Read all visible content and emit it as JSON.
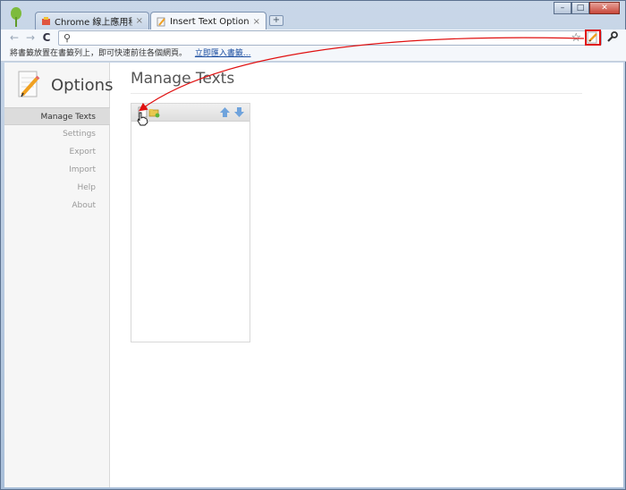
{
  "tabs": [
    {
      "label": "Chrome 線上應用程式商店",
      "close": "×",
      "active": false
    },
    {
      "label": "Insert Text Options",
      "close": "×",
      "active": true
    }
  ],
  "new_tab": "+",
  "window_controls": {
    "minimize": "–",
    "maximize": "□",
    "close": "✕"
  },
  "toolbar": {
    "back": "←",
    "forward": "→",
    "reload": "C",
    "search_icon": "⚲",
    "star_icon": "☆",
    "wrench_icon": "✎"
  },
  "bookmark_bar": {
    "message": "將書籤放置在書籤列上，即可快速前往各個網頁。",
    "link": "立即匯入書籤..."
  },
  "sidebar": {
    "title": "Options",
    "items": [
      {
        "label": "Manage Texts",
        "selected": true
      },
      {
        "label": "Settings",
        "selected": false
      },
      {
        "label": "Export",
        "selected": false
      },
      {
        "label": "Import",
        "selected": false
      },
      {
        "label": "Help",
        "selected": false
      },
      {
        "label": "About",
        "selected": false
      }
    ]
  },
  "main": {
    "title": "Manage Texts"
  },
  "colors": {
    "highlight": "#e01010",
    "link": "#1a4da0",
    "accent_arrow": "#6fa3dc"
  }
}
